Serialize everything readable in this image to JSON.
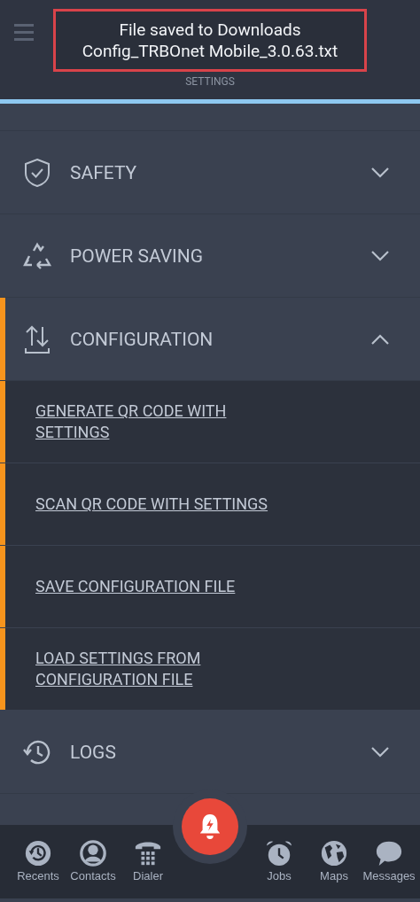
{
  "header": {
    "subtitle": "SETTINGS"
  },
  "toast": {
    "lines": [
      "File saved to Downloads",
      "Config_TRBOnet Mobile_3.0.63.txt"
    ]
  },
  "sections": [
    {
      "label": "SAFETY",
      "expanded": false
    },
    {
      "label": "POWER SAVING",
      "expanded": false
    },
    {
      "label": "CONFIGURATION",
      "expanded": true,
      "children": [
        {
          "label": "GENERATE QR CODE WITH SETTINGS"
        },
        {
          "label": "SCAN QR CODE WITH SETTINGS"
        },
        {
          "label": "SAVE CONFIGURATION FILE"
        },
        {
          "label": "LOAD SETTINGS FROM CONFIGURATION FILE"
        }
      ]
    },
    {
      "label": "LOGS",
      "expanded": false
    }
  ],
  "nav": [
    {
      "label": "Recents"
    },
    {
      "label": "Contacts"
    },
    {
      "label": "Dialer"
    },
    {
      "label": "Jobs"
    },
    {
      "label": "Maps"
    },
    {
      "label": "Messages"
    }
  ]
}
